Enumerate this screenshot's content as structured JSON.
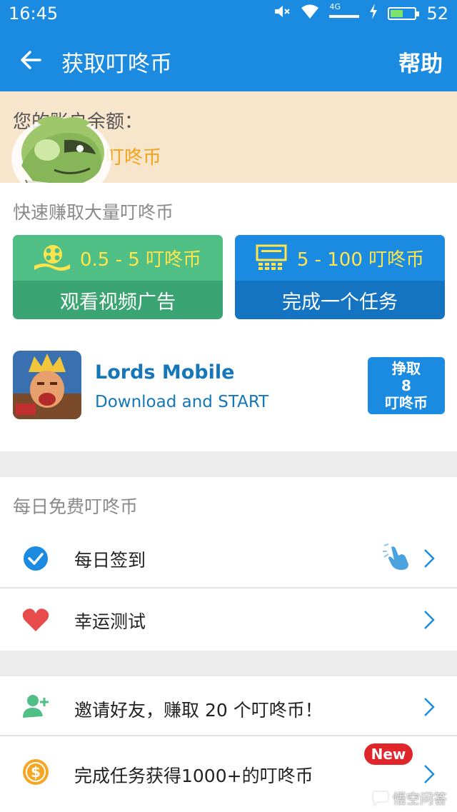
{
  "status_bar": {
    "time": "16:45",
    "network": "4G",
    "battery": "52",
    "battery_level": 0.52
  },
  "app_bar": {
    "title": "获取叮咚币",
    "help_label": "帮助",
    "back_icon": "arrow-left-icon"
  },
  "balance": {
    "label": "您的账户余额：",
    "value_visible": "叮咚币"
  },
  "earn": {
    "section_title": "快速赚取大量叮咚币",
    "cards": [
      {
        "reward": "0.5 - 5 叮咚币",
        "label": "观看视频广告",
        "icon": "film-reel-icon",
        "color": "#4fbf86"
      },
      {
        "reward": "5 - 100 叮咚币",
        "label": "完成一个任务",
        "icon": "theater-screen-icon",
        "color": "#1a8be0"
      }
    ],
    "offer": {
      "title": "Lords Mobile",
      "subtitle": "Download and START",
      "button_lines": [
        "挣取",
        "8",
        "叮咚币"
      ]
    }
  },
  "daily": {
    "section_title": "每日免费叮咚币",
    "items": [
      {
        "label": "每日签到",
        "icon": "check-circle-icon"
      },
      {
        "label": "幸运测试",
        "icon": "heart-icon"
      }
    ]
  },
  "more": {
    "items": [
      {
        "label": "邀请好友，赚取 20 个叮咚币！",
        "icon": "add-user-icon"
      },
      {
        "label": "完成任务获得1000+的叮咚币",
        "icon": "dollar-coin-icon",
        "badge": "New"
      }
    ]
  },
  "watermark": "悟空问答",
  "colors": {
    "primary": "#1a8be0",
    "accent_yellow": "#f2a31d",
    "green": "#4fbf86",
    "badge_red": "#e0262b"
  }
}
